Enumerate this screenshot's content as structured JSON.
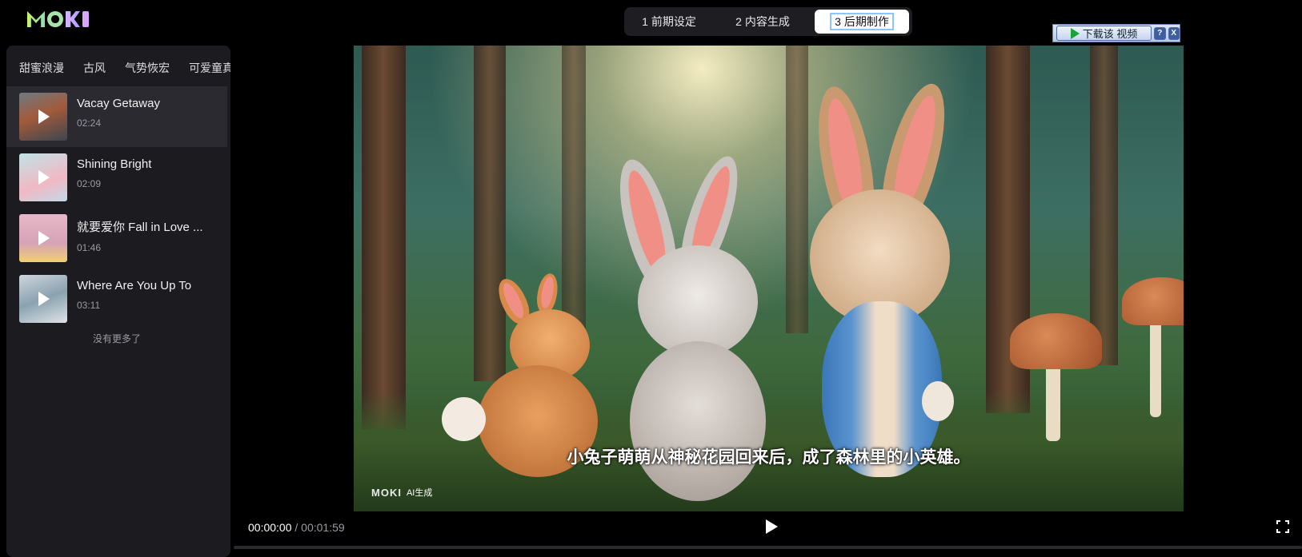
{
  "logo": {
    "text": "MOKI"
  },
  "steps": [
    {
      "label": "1 前期设定"
    },
    {
      "label": "2 内容生成"
    },
    {
      "label": "3 后期制作",
      "active": true
    }
  ],
  "download_widget": {
    "label": "下载该 视频",
    "help": "?",
    "close": "X"
  },
  "sidebar": {
    "tabs": [
      "甜蜜浪漫",
      "古风",
      "气势恢宏",
      "可爱童真"
    ],
    "tracks": [
      {
        "title": "Vacay Getaway",
        "duration": "02:24",
        "active": true
      },
      {
        "title": "Shining Bright",
        "duration": "02:09"
      },
      {
        "title": "就要爱你 Fall in Love ...",
        "duration": "01:46"
      },
      {
        "title": "Where Are You Up To",
        "duration": "03:11"
      }
    ],
    "no_more": "没有更多了"
  },
  "video": {
    "subtitle": "小兔子萌萌从神秘花园回来后，成了森林里的小英雄。",
    "watermark_logo": "MOKI",
    "watermark_text": "AI生成"
  },
  "player": {
    "current_time": "00:00:00",
    "separator": " / ",
    "total_time": "00:01:59",
    "progress": 0
  },
  "colors": {
    "background": "#000000",
    "sidebar": "#1c1c20",
    "active_row": "#2a2a30"
  }
}
